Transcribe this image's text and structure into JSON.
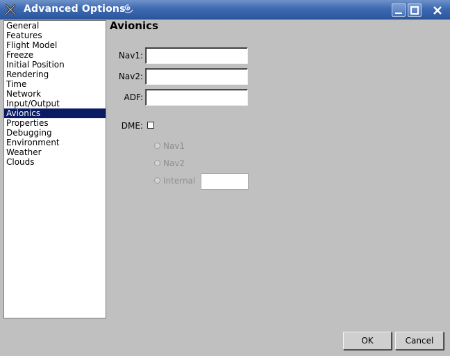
{
  "window": {
    "title": "Advanced Options",
    "minimize_label": "_",
    "maximize_label": "□",
    "close_label": "×"
  },
  "sidebar": {
    "items": [
      {
        "label": "General"
      },
      {
        "label": "Features"
      },
      {
        "label": "Flight Model"
      },
      {
        "label": "Freeze"
      },
      {
        "label": "Initial Position"
      },
      {
        "label": "Rendering"
      },
      {
        "label": "Time"
      },
      {
        "label": "Network"
      },
      {
        "label": "Input/Output"
      },
      {
        "label": "Avionics",
        "selected": true
      },
      {
        "label": "Properties"
      },
      {
        "label": "Debugging"
      },
      {
        "label": "Environment"
      },
      {
        "label": "Weather"
      },
      {
        "label": "Clouds"
      }
    ]
  },
  "panel": {
    "title": "Avionics",
    "nav1_label": "Nav1:",
    "nav1_value": "",
    "nav2_label": "Nav2:",
    "nav2_value": "",
    "adf_label": "ADF:",
    "adf_value": "",
    "dme_label": "DME:",
    "dme_checked": false,
    "dme_options": [
      {
        "label": "Nav1",
        "enabled": false
      },
      {
        "label": "Nav2",
        "enabled": false
      },
      {
        "label": "Internal",
        "enabled": false
      }
    ],
    "internal_value": ""
  },
  "buttons": {
    "ok_label": "OK",
    "cancel_label": "Cancel"
  },
  "colors": {
    "selection": "#0a1b64",
    "titlebar": "#3e6ab2",
    "background": "#c0c0c0"
  }
}
